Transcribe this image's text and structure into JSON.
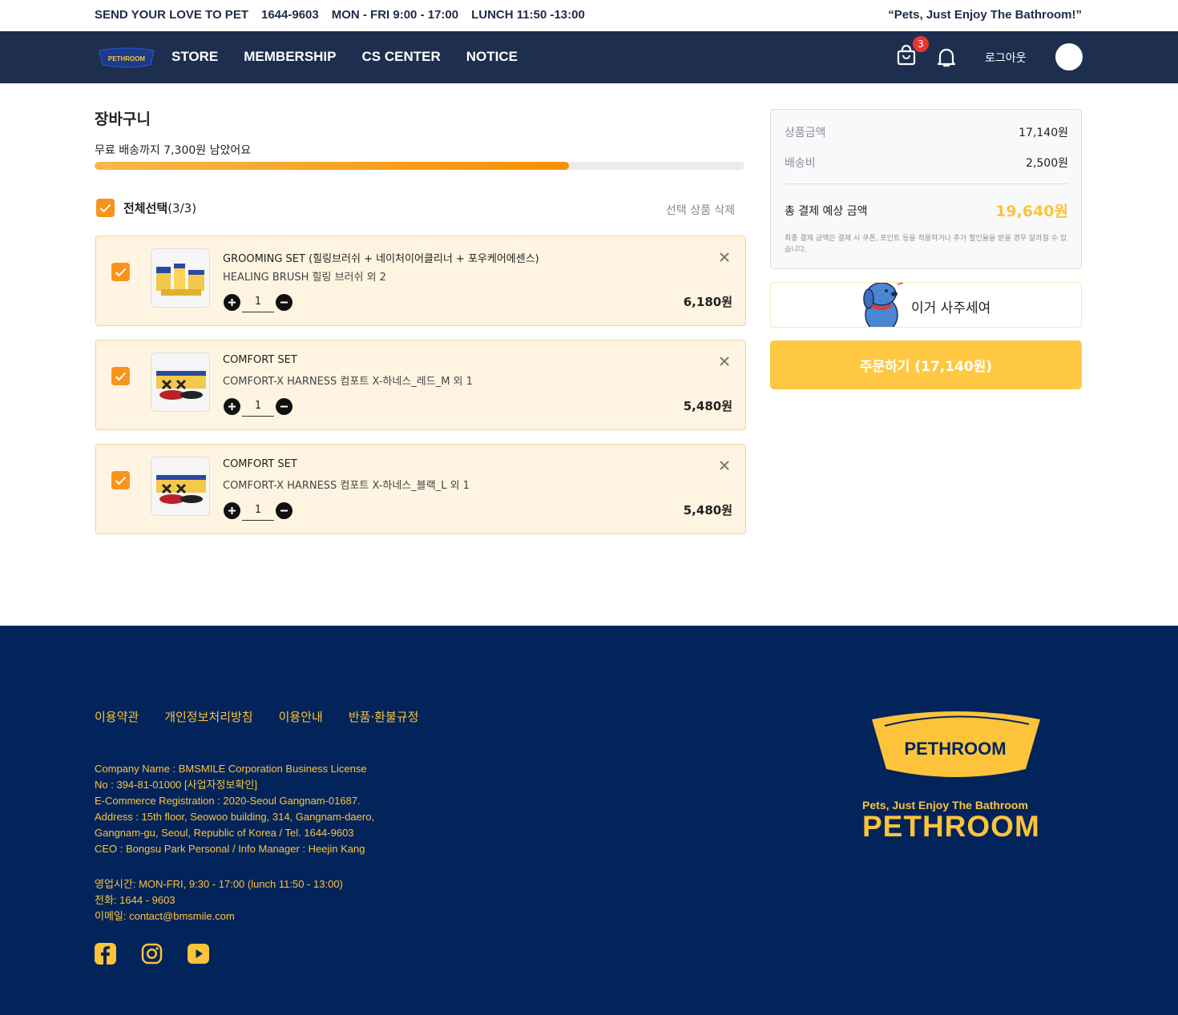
{
  "topbar": {
    "slogan": "SEND YOUR LOVE TO PET",
    "phone": "1644-9603",
    "hours": "MON - FRI 9:00 - 17:00",
    "lunch": "LUNCH 11:50 -13:00",
    "tagline": "“Pets, Just Enjoy The Bathroom!”"
  },
  "nav": {
    "logo_text": "PETHROOM",
    "links": [
      "STORE",
      "MEMBERSHIP",
      "CS CENTER",
      "NOTICE"
    ],
    "cart_count": "3",
    "logout_label": "로그아웃"
  },
  "cart": {
    "title": "장바구니",
    "free_shipping_text": "무료 배송까지 7,300원 남았어요",
    "free_shipping_progress": 0.73,
    "select_all_label": "전체선택",
    "select_all_count": "(3/3)",
    "delete_selected_label": "선택 상품 삭제",
    "items": [
      {
        "name": "GROOMING SET (힐링브러쉬 + 네이처이어클리너 + 포우케어에센스)",
        "option": "HEALING BRUSH 힐링 브러쉬 외 2",
        "qty": "1",
        "price": "6,180원",
        "checked": true
      },
      {
        "name": "COMFORT SET",
        "option": "COMFORT-X HARNESS 컴포트 X-하네스_레드_M 외 1",
        "qty": "1",
        "price": "5,480원",
        "checked": true
      },
      {
        "name": "COMFORT SET",
        "option": "COMFORT-X HARNESS 컴포트 X-하네스_블랙_L 외 1",
        "qty": "1",
        "price": "5,480원",
        "checked": true
      }
    ]
  },
  "summary": {
    "product_label": "상품금액",
    "product_value": "17,140원",
    "shipping_label": "배송비",
    "shipping_value": "2,500원",
    "total_label": "총 결제 예상 금액",
    "total_value": "19,640원",
    "note": "최종 결제 금액은 결제 시 쿠폰, 포인트 등을 적용하거나 추가 할인율을 받을 경우 달라질 수 있습니다.",
    "gift_label": "이거 사주세여",
    "order_label": "주문하기 (17,140원)"
  },
  "footer": {
    "links": [
      "이용약관",
      "개인정보처리방침",
      "이용안내",
      "반품·환불규정"
    ],
    "company_lines": [
      "Company Name : BMSMILE Corporation Business License",
      "No : 394-81-01000 [사업자정보확인]",
      "E-Commerce Registration : 2020-Seoul Gangnam-01687.",
      "Address : 15th floor, Seowoo building, 314, Gangnam-daero,",
      "Gangnam-gu, Seoul, Republic of Korea / Tel. 1644-9603",
      "CEO : Bongsu Park Personal / Info Manager : Heejin Kang"
    ],
    "contact_lines": [
      "영업시간: MON-FRI, 9:30 - 17:00 (lunch 11:50 - 13:00)",
      "전화: 1644 - 9603",
      "이메일: contact@bmsmile.com"
    ],
    "social_icons": [
      "facebook-icon",
      "instagram-icon",
      "youtube-icon"
    ],
    "logo_text": "PETHROOM",
    "brand_tagline": "Pets, Just Enjoy The Bathroom",
    "brand_name": "PETHROOM"
  },
  "colors": {
    "nav_bg": "#1e2e4f",
    "accent_orange": "#f7941d",
    "accent_yellow": "#fdc33a",
    "footer_bg": "#02245a",
    "item_bg": "#fff4e1"
  }
}
